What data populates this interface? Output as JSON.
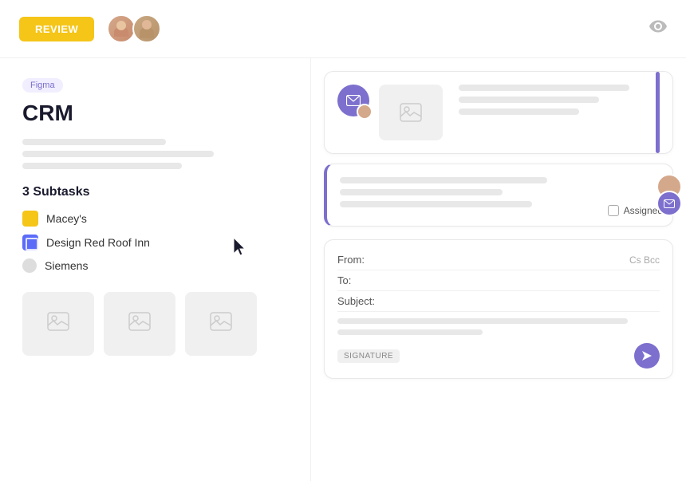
{
  "topbar": {
    "review_label": "REVIEW",
    "eye_icon": "👁"
  },
  "left": {
    "figma_badge": "Figma",
    "title": "CRM",
    "subtasks_heading": "3 Subtasks",
    "subtasks": [
      {
        "id": 1,
        "label": "Macey's",
        "icon_type": "yellow"
      },
      {
        "id": 2,
        "label": "Design Red Roof Inn",
        "icon_type": "blue"
      },
      {
        "id": 3,
        "label": "Siemens",
        "icon_type": "gray"
      }
    ]
  },
  "right": {
    "email_cards": [
      {
        "id": 1,
        "has_image": true,
        "assigned": false
      },
      {
        "id": 2,
        "assigned": true,
        "assigned_label": "Assigned"
      }
    ],
    "compose": {
      "from_label": "From:",
      "to_label": "To:",
      "subject_label": "Subject:",
      "cc_bcc_label": "Cs Bcc",
      "signature_label": "SIGNATURE"
    }
  }
}
